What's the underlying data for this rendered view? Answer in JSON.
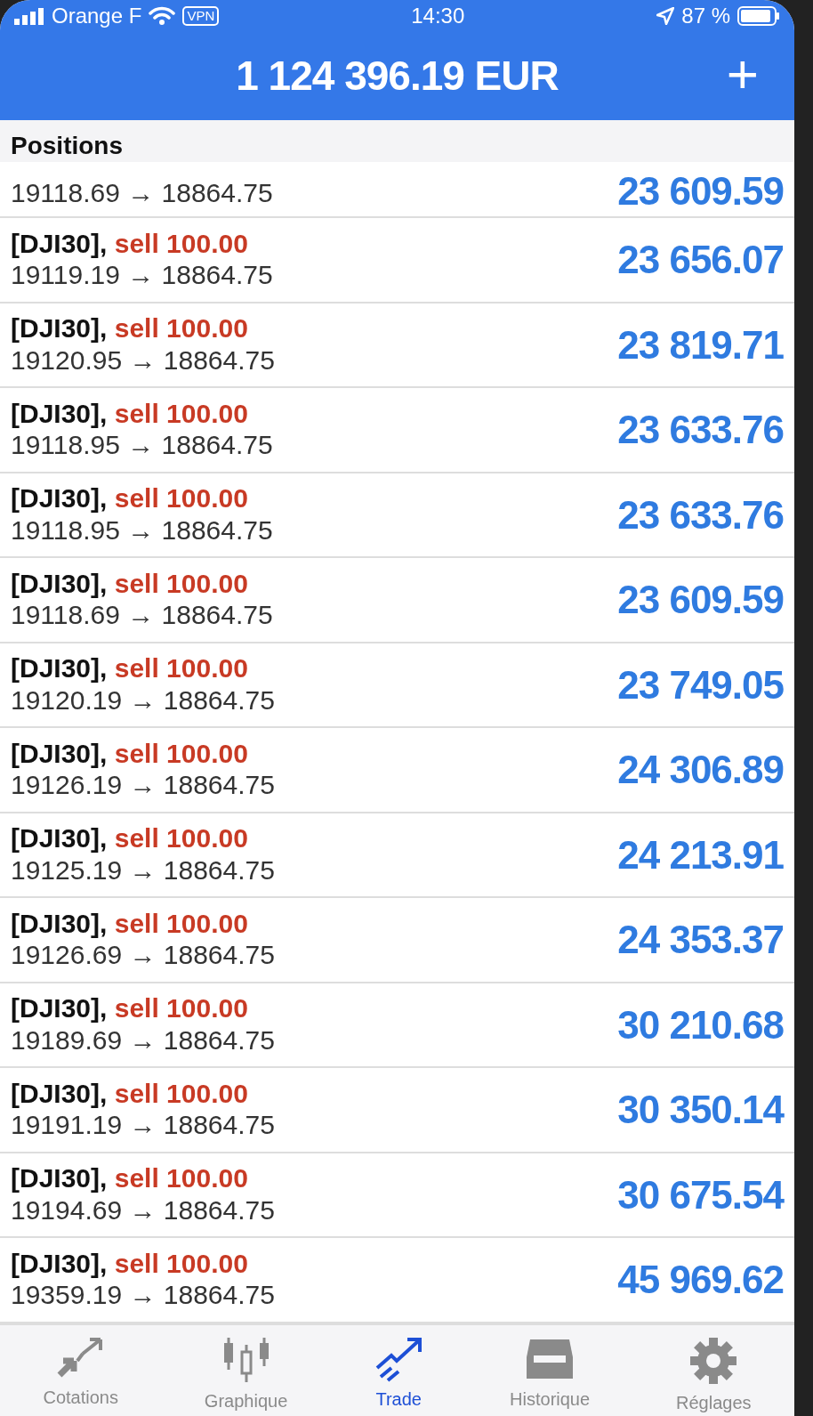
{
  "status_bar": {
    "carrier": "Orange F",
    "vpn": "VPN",
    "time": "14:30",
    "battery": "87 %"
  },
  "header": {
    "title": "1 124 396.19 EUR",
    "action": "+"
  },
  "section": {
    "title": "Positions"
  },
  "positions": [
    {
      "kind": "partial",
      "prices": "19118.69 → 18864.75",
      "profit": "23 609.59"
    },
    {
      "kind": "full",
      "symbol": "[DJI30],",
      "order": "sell 100.00",
      "prices": "19119.19 → 18864.75",
      "profit": "23 656.07"
    },
    {
      "kind": "full",
      "symbol": "[DJI30],",
      "order": "sell 100.00",
      "prices": "19120.95 → 18864.75",
      "profit": "23 819.71"
    },
    {
      "kind": "full",
      "symbol": "[DJI30],",
      "order": "sell 100.00",
      "prices": "19118.95 → 18864.75",
      "profit": "23 633.76"
    },
    {
      "kind": "full",
      "symbol": "[DJI30],",
      "order": "sell 100.00",
      "prices": "19118.95 → 18864.75",
      "profit": "23 633.76"
    },
    {
      "kind": "full",
      "symbol": "[DJI30],",
      "order": "sell 100.00",
      "prices": "19118.69 → 18864.75",
      "profit": "23 609.59"
    },
    {
      "kind": "full",
      "symbol": "[DJI30],",
      "order": "sell 100.00",
      "prices": "19120.19 → 18864.75",
      "profit": "23 749.05"
    },
    {
      "kind": "full",
      "symbol": "[DJI30],",
      "order": "sell 100.00",
      "prices": "19126.19 → 18864.75",
      "profit": "24 306.89"
    },
    {
      "kind": "full",
      "symbol": "[DJI30],",
      "order": "sell 100.00",
      "prices": "19125.19 → 18864.75",
      "profit": "24 213.91"
    },
    {
      "kind": "full",
      "symbol": "[DJI30],",
      "order": "sell 100.00",
      "prices": "19126.69 → 18864.75",
      "profit": "24 353.37"
    },
    {
      "kind": "full",
      "symbol": "[DJI30],",
      "order": "sell 100.00",
      "prices": "19189.69 → 18864.75",
      "profit": "30 210.68"
    },
    {
      "kind": "full",
      "symbol": "[DJI30],",
      "order": "sell 100.00",
      "prices": "19191.19 → 18864.75",
      "profit": "30 350.14"
    },
    {
      "kind": "full",
      "symbol": "[DJI30],",
      "order": "sell 100.00",
      "prices": "19194.69 → 18864.75",
      "profit": "30 675.54"
    },
    {
      "kind": "full",
      "symbol": "[DJI30],",
      "order": "sell 100.00",
      "prices": "19359.19 → 18864.75",
      "profit": "45 969.62"
    }
  ],
  "tabs": [
    {
      "label": "Cotations",
      "kind": "arrows",
      "selected": false
    },
    {
      "label": "Graphique",
      "kind": "candles",
      "selected": false
    },
    {
      "label": "Trade",
      "kind": "trend",
      "selected": true
    },
    {
      "label": "Historique",
      "kind": "inbox",
      "selected": false
    },
    {
      "label": "Réglages",
      "kind": "gear",
      "selected": false
    }
  ]
}
